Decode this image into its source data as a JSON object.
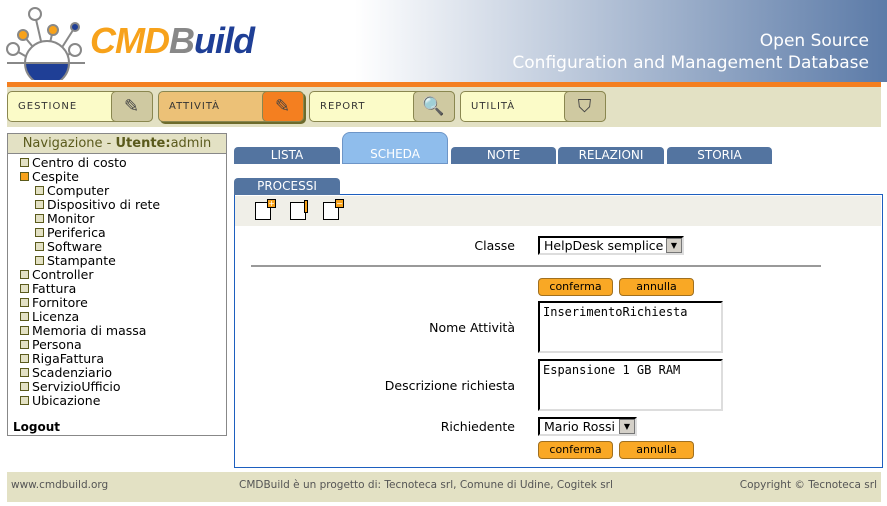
{
  "header": {
    "logo": "CMDBuild",
    "logo_parts": [
      "CMD",
      "B",
      "uild"
    ],
    "tagline1": "Open Source",
    "tagline2": "Configuration and Management Database"
  },
  "menu": [
    {
      "label": "GESTIONE",
      "icon": "pen-icon"
    },
    {
      "label": "ATTIVITÀ",
      "icon": "pen-icon",
      "active": true
    },
    {
      "label": "REPORT",
      "icon": "report-magnifier-icon"
    },
    {
      "label": "UTILITÀ",
      "icon": "tools-icon"
    }
  ],
  "nav": {
    "title": "Navigazione - ",
    "user_label": "Utente:",
    "user": "admin",
    "logout": "Logout",
    "items": [
      "Centro di costo",
      "Cespite",
      "Computer",
      "Dispositivo di rete",
      "Monitor",
      "Periferica",
      "Software",
      "Stampante",
      "Controller",
      "Fattura",
      "Fornitore",
      "Licenza",
      "Memoria di massa",
      "Persona",
      "RigaFattura",
      "Scadenziario",
      "ServizioUfficio",
      "Ubicazione"
    ]
  },
  "tabs": [
    "LISTA",
    "SCHEDA",
    "NOTE",
    "RELAZIONI",
    "STORIA"
  ],
  "active_tab": "SCHEDA",
  "subtab": "PROCESSI",
  "toolbar": [
    "add-card-icon",
    "edit-card-icon",
    "remove-card-icon"
  ],
  "form": {
    "classe_label": "Classe",
    "classe_value": "HelpDesk semplice",
    "confirm": "conferma",
    "cancel": "annulla",
    "nome_label": "Nome Attività",
    "nome_value": "InserimentoRichiesta",
    "desc_label": "Descrizione richiesta",
    "desc_value": "Espansione 1 GB RAM",
    "rich_label": "Richiedente",
    "rich_value": "Mario Rossi"
  },
  "footer": {
    "left": "www.cmdbuild.org",
    "center": "CMDBuild è un progetto di: Tecnoteca srl, Comune di Udine, Cogitek srl",
    "right": "Copyright © Tecnoteca srl"
  },
  "colors": {
    "accent": "#f47f20",
    "tab_blue": "#5374a0",
    "tab_selected": "#8fbdec",
    "beige": "#e3e1c4"
  }
}
